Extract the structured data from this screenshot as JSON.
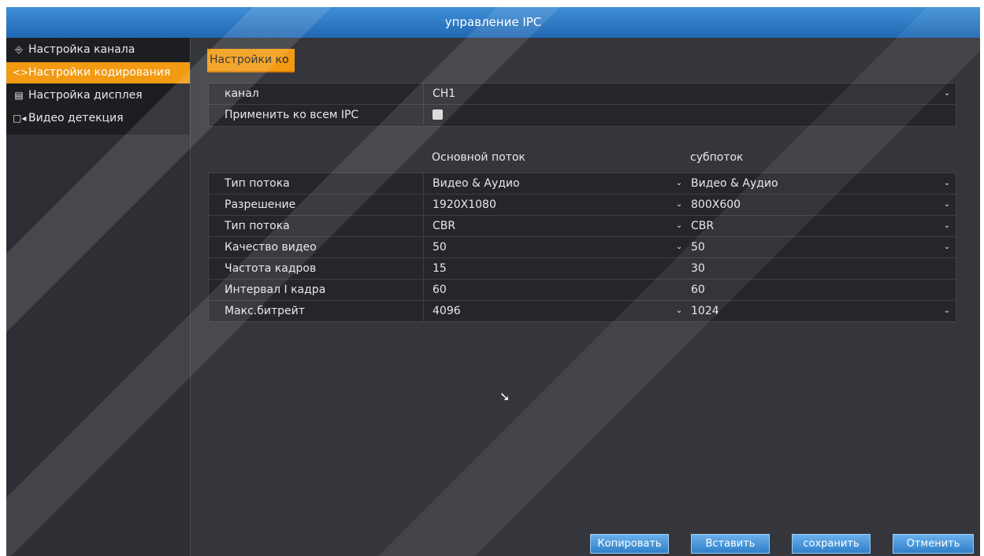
{
  "window": {
    "title": "управление IPC"
  },
  "sidebar": {
    "items": [
      {
        "icon": "⎆",
        "label": "Настройка канала",
        "active": false
      },
      {
        "icon": "<>",
        "label": "Настройки кодирования",
        "active": true
      },
      {
        "icon": "▤",
        "label": "Настройка дисплея",
        "active": false
      },
      {
        "icon": "□◂",
        "label": "Видео детекция",
        "active": false
      }
    ]
  },
  "main": {
    "tab_label": "Настройки ко",
    "channel": {
      "label": "канал",
      "value": "CH1"
    },
    "apply_all": {
      "label": "Применить ко всем IPC",
      "checked": false
    },
    "stream_headers": {
      "main": "Основной поток",
      "sub": "субпоток"
    },
    "rows": [
      {
        "label": "Тип потока",
        "main": "Видео & Аудио",
        "sub": "Видео & Аудио"
      },
      {
        "label": "Разрешение",
        "main": "1920X1080",
        "sub": "800X600"
      },
      {
        "label": "Тип потока",
        "main": "CBR",
        "sub": "CBR"
      },
      {
        "label": "Качество видео",
        "main": "50",
        "sub": "50"
      },
      {
        "label": "Частота кадров",
        "main": "15",
        "sub": "30"
      },
      {
        "label": "Интервал I кадра",
        "main": "60",
        "sub": "60"
      },
      {
        "label": "Макс.битрейт",
        "main": "4096",
        "sub": "1024"
      }
    ]
  },
  "buttons": {
    "copy": "Копировать",
    "paste": "Вставить",
    "save": "сохранить",
    "cancel": "Отменить"
  },
  "colors": {
    "accent": "#f29a12",
    "title_bar": "#2f7fc9",
    "background": "#35363b"
  }
}
